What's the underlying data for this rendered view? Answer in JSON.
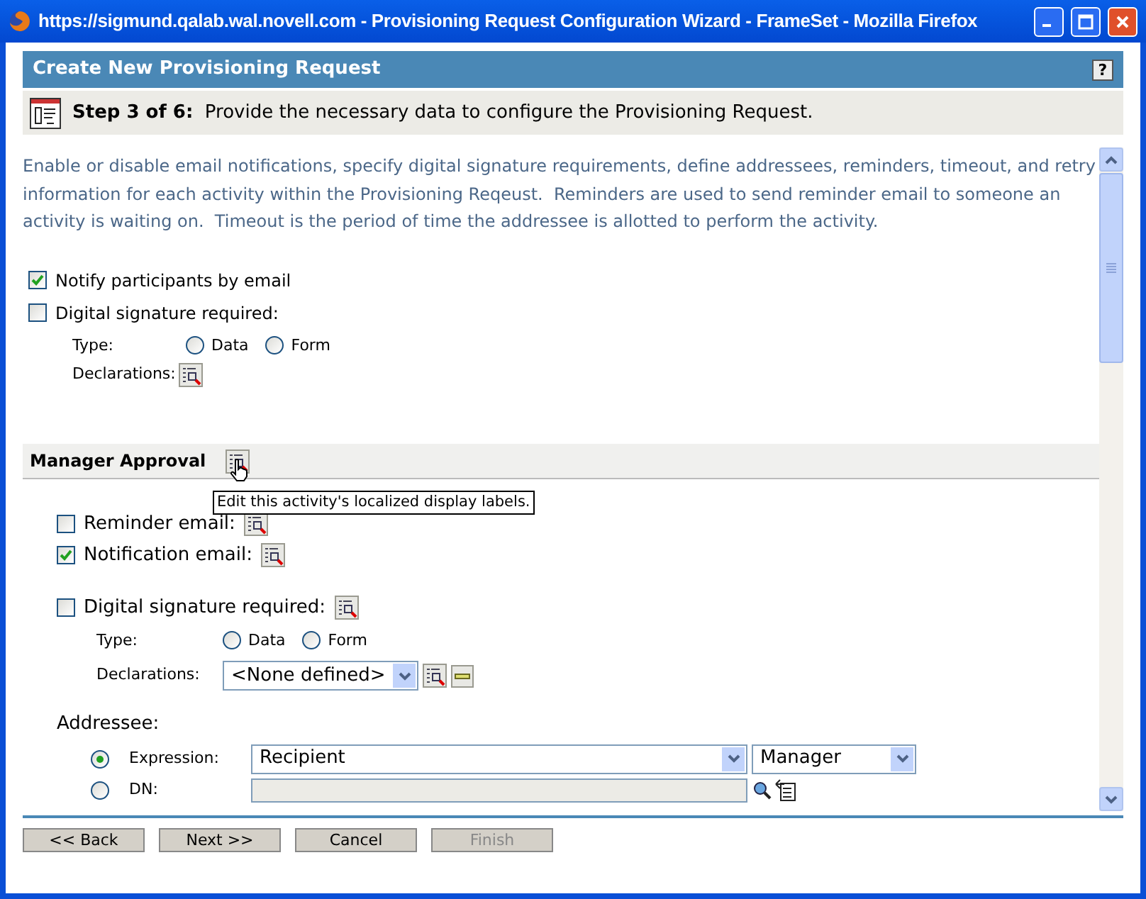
{
  "window": {
    "title": "https://sigmund.qalab.wal.novell.com - Provisioning Request Configuration Wizard - FrameSet - Mozilla Firefox"
  },
  "header": {
    "title": "Create New Provisioning Request",
    "help": "?"
  },
  "step": {
    "label": "Step 3 of 6:",
    "text": "Provide the necessary data to configure the Provisioning Request."
  },
  "intro": "Enable or disable email notifications, specify digital signature requirements, define addressees, reminders, timeout, and retry information for each activity within the Provisioning Reqeust.  Reminders are used to send reminder email to someone an activity is waiting on.  Timeout is the period of time the addressee is allotted to perform the activity.",
  "notify": {
    "label": "Notify participants by email",
    "checked": true
  },
  "signature": {
    "label": "Digital signature required:",
    "checked": false,
    "type_label": "Type:",
    "types": [
      {
        "label": "Data",
        "selected": false
      },
      {
        "label": "Form",
        "selected": false
      }
    ],
    "declarations_label": "Declarations:"
  },
  "activity": {
    "title": "Manager Approval",
    "tooltip": "Edit this activity's localized display labels.",
    "reminder": {
      "label": "Reminder email:",
      "checked": false
    },
    "notification": {
      "label": "Notification email:",
      "checked": true
    },
    "signature": {
      "label": "Digital signature required:",
      "checked": false,
      "type_label": "Type:",
      "types": [
        {
          "label": "Data",
          "selected": false
        },
        {
          "label": "Form",
          "selected": false
        }
      ],
      "declarations_label": "Declarations:",
      "declarations_value": "<None defined>"
    },
    "addressee": {
      "label": "Addressee:",
      "options": [
        {
          "label": "Expression:",
          "selected": true
        },
        {
          "label": "DN:",
          "selected": false
        }
      ],
      "expression": "Recipient",
      "expression_qualifier": "Manager"
    }
  },
  "buttons": [
    {
      "label": "<< Back",
      "disabled": false
    },
    {
      "label": "Next >>",
      "disabled": false
    },
    {
      "label": "Cancel",
      "disabled": false
    },
    {
      "label": "Finish",
      "disabled": true
    }
  ]
}
